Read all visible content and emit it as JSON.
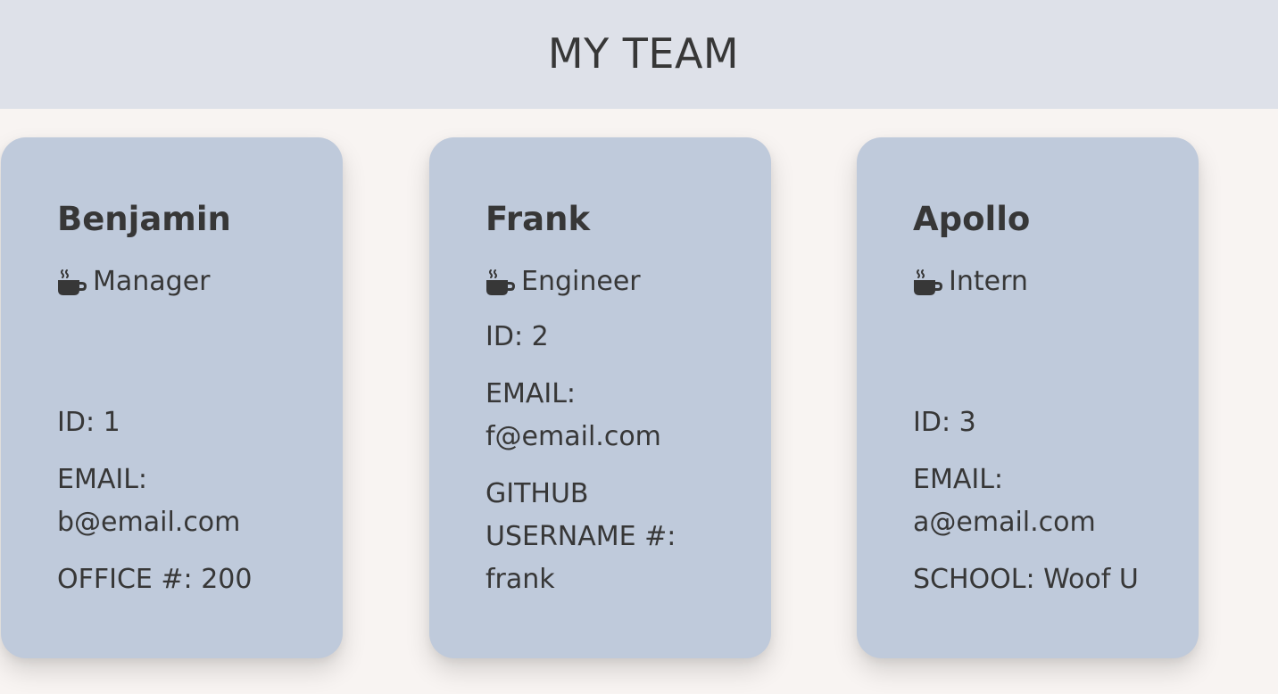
{
  "header": {
    "title": "MY TEAM"
  },
  "cards": [
    {
      "name": "Benjamin",
      "role": "Manager",
      "role_icon": "coffee-icon",
      "id_text": "ID: 1",
      "email_label": "EMAIL:",
      "email": "b@email.com",
      "extra_label": "OFFICE #:",
      "extra_value": "200",
      "extra_text": "OFFICE #: 200"
    },
    {
      "name": "Frank",
      "role": "Engineer",
      "role_icon": "coffee-icon",
      "id_text": "ID: 2",
      "email_label": "EMAIL:",
      "email": "f@email.com",
      "extra_label": "GITHUB USERNAME #:",
      "extra_value": "frank",
      "extra_text": "GITHUB USERNAME #: frank"
    },
    {
      "name": "Apollo",
      "role": "Intern",
      "role_icon": "coffee-icon",
      "id_text": "ID: 3",
      "email_label": "EMAIL:",
      "email": "a@email.com",
      "extra_label": "SCHOOL:",
      "extra_value": "Woof U",
      "extra_text": "SCHOOL: Woof U"
    }
  ],
  "colors": {
    "header_bg": "#dee1e9",
    "page_bg": "#f8f4f2",
    "card_bg": "#bfcadb",
    "text": "#373737"
  }
}
